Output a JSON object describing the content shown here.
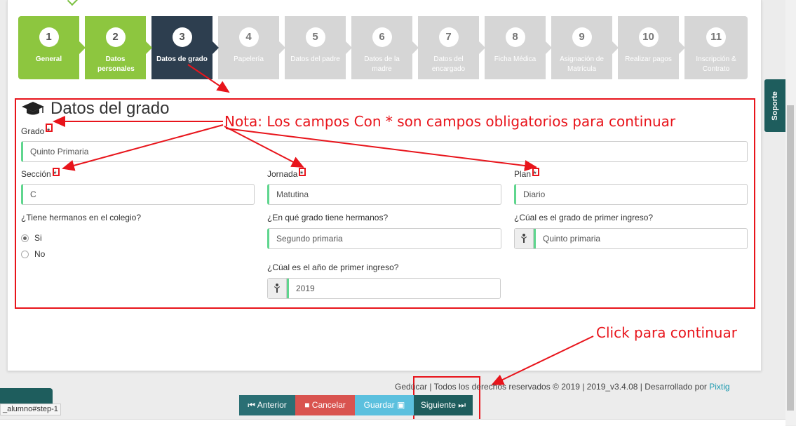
{
  "wizard": {
    "steps": [
      {
        "num": "1",
        "label": "General",
        "state": "done"
      },
      {
        "num": "2",
        "label": "Datos personales",
        "state": "done"
      },
      {
        "num": "3",
        "label": "Datos de grado",
        "state": "active"
      },
      {
        "num": "4",
        "label": "Papelería",
        "state": "pending"
      },
      {
        "num": "5",
        "label": "Datos del padre",
        "state": "pending"
      },
      {
        "num": "6",
        "label": "Datos de la madre",
        "state": "pending"
      },
      {
        "num": "7",
        "label": "Datos del encargado",
        "state": "pending"
      },
      {
        "num": "8",
        "label": "Ficha Médica",
        "state": "pending"
      },
      {
        "num": "9",
        "label": "Asignación de Matrícula",
        "state": "pending"
      },
      {
        "num": "10",
        "label": "Realizar pagos",
        "state": "pending"
      },
      {
        "num": "11",
        "label": "Inscripción & Contrato",
        "state": "pending"
      }
    ]
  },
  "form": {
    "title": "Datos del grado",
    "grado_label": "Grado",
    "grado_value": "Quinto Primaria",
    "seccion_label": "Sección",
    "seccion_value": "C",
    "jornada_label": "Jornada",
    "jornada_value": "Matutina",
    "plan_label": "Plan",
    "plan_value": "Diario",
    "required_mark": "*",
    "hermanos_label": "¿Tiene hermanos en el colegio?",
    "radio_si": "Si",
    "radio_no": "No",
    "grado_hermanos_label": "¿En qué grado tiene hermanos?",
    "grado_hermanos_value": "Segundo primaria",
    "grado_ingreso_label": "¿Cúal es el grado de primer ingreso?",
    "grado_ingreso_value": "Quinto primaria",
    "anio_ingreso_label": "¿Cúal es el año de primer ingreso?",
    "anio_ingreso_value": "2019"
  },
  "annotations": {
    "note": "Nota: Los campos Con * son campos obligatorios para continuar",
    "click": "Click para continuar"
  },
  "footer": {
    "brand": "Gedúcar",
    "text": " | Todos los derechos reservados © 2019 | 2019_v3.4.08 | Desarrollado por ",
    "dev": "Pixtig"
  },
  "buttons": {
    "anterior": "Anterior",
    "cancelar": "Cancelar",
    "guardar": "Guardar",
    "siguiente": "Siguiente"
  },
  "sidetab": "Soporte",
  "status_url": "_alumno#step-1",
  "colors": {
    "done": "#8dc63f",
    "active": "#2d3e4f",
    "pending": "#d6d6d6",
    "anterior": "#2a6f74",
    "cancelar": "#d9534f",
    "guardar": "#5bc0de",
    "siguiente": "#1e5d5d",
    "annotation": "#e8141b"
  },
  "icons": {
    "title": "graduation-cap-icon",
    "addon": "child-icon"
  }
}
